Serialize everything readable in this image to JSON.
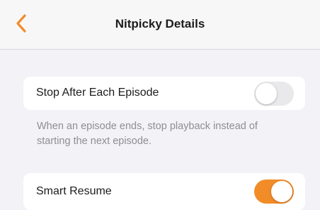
{
  "nav": {
    "title": "Nitpicky Details",
    "back_icon": "chevron-left-icon"
  },
  "colors": {
    "accent": "#f28c28",
    "toggle_off": "#e9e9eb",
    "background": "#f2f2f7",
    "footer_text": "#8e8e93"
  },
  "settings": [
    {
      "label": "Stop After Each Episode",
      "enabled": false,
      "footer": "When an episode ends, stop playback instead of starting the next episode."
    },
    {
      "label": "Smart Resume",
      "enabled": true
    }
  ]
}
